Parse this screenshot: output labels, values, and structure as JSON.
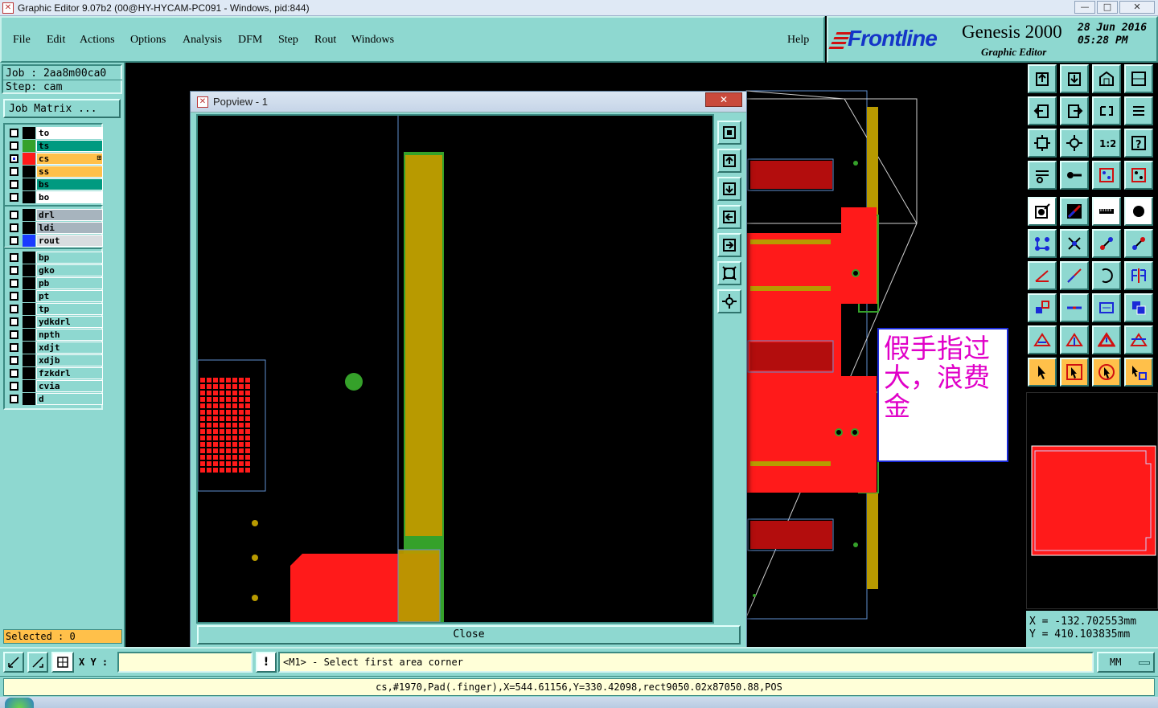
{
  "window": {
    "title": "Graphic Editor 9.07b2 (00@HY-HYCAM-PC091 - Windows, pid:844)",
    "app_icon": "x-box-icon",
    "minimize": "—",
    "maximize": "□",
    "close": "✕"
  },
  "menu": [
    "File",
    "Edit",
    "Actions",
    "Options",
    "Analysis",
    "DFM",
    "Step",
    "Rout",
    "Windows"
  ],
  "help": "Help",
  "brand": {
    "logo": "Frontline",
    "product": "Genesis 2000",
    "subtitle": "Graphic Editor",
    "date": "28 Jun 2016",
    "time": "05:28 PM"
  },
  "job": {
    "job_label": "Job : 2aa8m00ca0",
    "step_label": "Step: cam",
    "matrix_button": "Job Matrix ..."
  },
  "layers": {
    "group1": [
      {
        "name": "to",
        "color": "#ffffff",
        "swatch": "#000000",
        "checked": false
      },
      {
        "name": "ts",
        "color": "#009a80",
        "swatch": "#35a12a",
        "checked": false
      },
      {
        "name": "cs",
        "color": "#ffc04a",
        "swatch": "#ff1a1a",
        "checked": true,
        "mark": "⊞"
      },
      {
        "name": "ss",
        "color": "#ffc04a",
        "swatch": "#000000",
        "checked": false
      },
      {
        "name": "bs",
        "color": "#009a80",
        "swatch": "#000000",
        "checked": false
      },
      {
        "name": "bo",
        "color": "#ffffff",
        "swatch": "#000000",
        "checked": false
      }
    ],
    "group2": [
      {
        "name": "drl",
        "color": "#a7b4be",
        "swatch": "#000000",
        "checked": false
      },
      {
        "name": "ldi",
        "color": "#a7b4be",
        "swatch": "#000000",
        "checked": false
      },
      {
        "name": "rout",
        "color": "#d9dde0",
        "swatch": "#1a3bff",
        "checked": false
      }
    ],
    "group3": [
      {
        "name": "bp",
        "color": "#8ed8d0",
        "swatch": "#000000",
        "checked": false
      },
      {
        "name": "gko",
        "color": "#8ed8d0",
        "swatch": "#000000",
        "checked": false
      },
      {
        "name": "pb",
        "color": "#8ed8d0",
        "swatch": "#000000",
        "checked": false
      },
      {
        "name": "pt",
        "color": "#8ed8d0",
        "swatch": "#000000",
        "checked": false
      },
      {
        "name": "tp",
        "color": "#8ed8d0",
        "swatch": "#000000",
        "checked": false
      },
      {
        "name": "ydkdrl",
        "color": "#8ed8d0",
        "swatch": "#000000",
        "checked": false
      },
      {
        "name": "npth",
        "color": "#8ed8d0",
        "swatch": "#000000",
        "checked": false
      },
      {
        "name": "xdjt",
        "color": "#8ed8d0",
        "swatch": "#000000",
        "checked": false
      },
      {
        "name": "xdjb",
        "color": "#8ed8d0",
        "swatch": "#000000",
        "checked": false
      },
      {
        "name": "fzkdrl",
        "color": "#8ed8d0",
        "swatch": "#000000",
        "checked": false
      },
      {
        "name": "cvia",
        "color": "#8ed8d0",
        "swatch": "#000000",
        "checked": false
      },
      {
        "name": "d",
        "color": "#8ed8d0",
        "swatch": "#000000",
        "checked": false
      }
    ]
  },
  "selected_label": "Selected : 0",
  "popview": {
    "title": "Popview - 1",
    "close_button": "Close",
    "close_icon": "✕"
  },
  "annotation": "假手指过大，浪费金",
  "coords": {
    "x": "X = -132.702553mm",
    "y": "Y = 410.103835mm"
  },
  "status": {
    "xy_label": "X Y :",
    "xy_value": "",
    "prompt": "<M1> - Select first area corner",
    "units": "MM"
  },
  "info": "cs,#1970,Pad(.finger),X=544.61156,Y=330.42098,rect9050.02x87050.88,POS",
  "colors": {
    "panel": "#8ed8d0",
    "copper": "#ff1a1a",
    "gold": "#b89a00",
    "green": "#35a12a",
    "annotation": "#e000c8"
  }
}
